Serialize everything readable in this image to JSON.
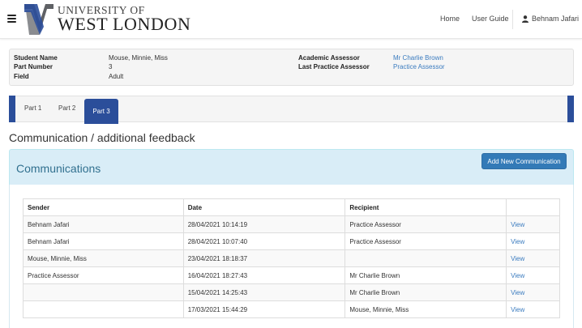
{
  "header": {
    "logo_top": "UNIVERSITY OF",
    "logo_main": "WEST LONDON",
    "nav": {
      "home": "Home",
      "user_guide": "User Guide",
      "user": "Behnam Jafari"
    },
    "logo_color": "#2b4e9a"
  },
  "student_info": {
    "name_label": "Student Name",
    "name_value": "Mouse, Minnie, Miss",
    "part_label": "Part Number",
    "part_value": "3",
    "field_label": "Field",
    "field_value": "Adult",
    "academic_label": "Academic Assessor",
    "academic_value": "Mr Charlie Brown",
    "practice_label": "Last Practice Assessor",
    "practice_value": "Practice Assessor"
  },
  "tabs": [
    {
      "label": "Part 1"
    },
    {
      "label": "Part 2"
    },
    {
      "label": "Part 3",
      "active": true
    }
  ],
  "page_title": "Communication / additional feedback",
  "panel": {
    "title": "Communications",
    "add_button": "Add New Communication"
  },
  "table": {
    "headers": {
      "sender": "Sender",
      "date": "Date",
      "recipient": "Recipient"
    },
    "rows": [
      {
        "sender": "Behnam Jafari",
        "date": "28/04/2021 10:14:19",
        "recipient": "Practice Assessor",
        "action": "View"
      },
      {
        "sender": "Behnam Jafari",
        "date": "28/04/2021 10:07:40",
        "recipient": "Practice Assessor",
        "action": "View"
      },
      {
        "sender": "Mouse, Minnie, Miss",
        "date": "23/04/2021 18:18:37",
        "recipient": "",
        "action": "View"
      },
      {
        "sender": "Practice Assessor",
        "date": "16/04/2021 18:27:43",
        "recipient": "Mr Charlie Brown",
        "action": "View"
      },
      {
        "sender": "",
        "date": "15/04/2021 14:25:43",
        "recipient": "Mr Charlie Brown",
        "action": "View"
      },
      {
        "sender": "",
        "date": "17/03/2021 15:44:29",
        "recipient": "Mouse, Minnie, Miss",
        "action": "View"
      }
    ]
  }
}
